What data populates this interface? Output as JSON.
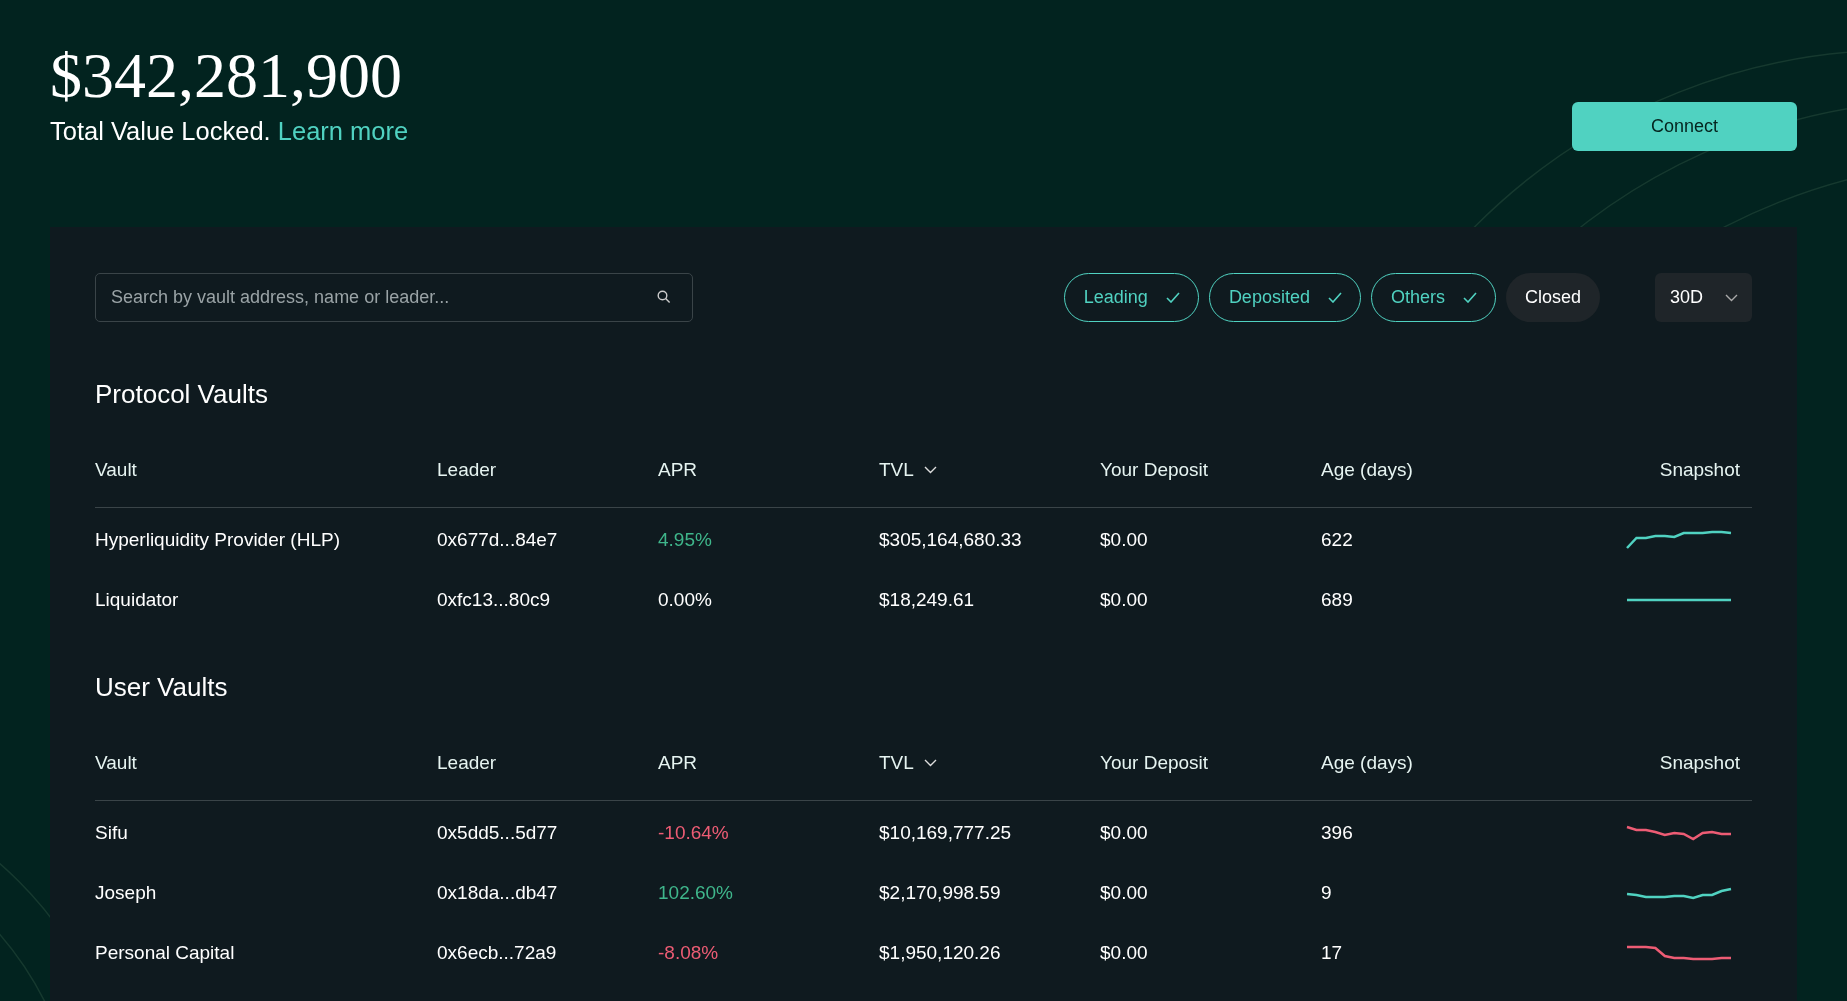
{
  "tvl": {
    "amount": "$342,281,900",
    "label": "Total Value Locked.",
    "link": "Learn more"
  },
  "connect_button": "Connect",
  "search": {
    "placeholder": "Search by vault address, name or leader..."
  },
  "filters": [
    {
      "label": "Leading",
      "selected": true
    },
    {
      "label": "Deposited",
      "selected": true
    },
    {
      "label": "Others",
      "selected": true
    },
    {
      "label": "Closed",
      "selected": false
    }
  ],
  "period_dropdown": "30D",
  "sections": [
    {
      "title": "Protocol Vaults",
      "columns": [
        "Vault",
        "Leader",
        "APR",
        "TVL",
        "Your Deposit",
        "Age (days)",
        "Snapshot"
      ],
      "rows": [
        {
          "vault": "Hyperliquidity Provider (HLP)",
          "leader": "0x677d...84e7",
          "apr": {
            "text": "4.95%",
            "color": "#3fb68b"
          },
          "tvl": "$305,164,680.33",
          "deposit": "$0.00",
          "age": "622",
          "snapshot": {
            "color": "#50d2c1"
          }
        },
        {
          "vault": "Liquidator",
          "leader": "0xfc13...80c9",
          "apr": {
            "text": "0.00%",
            "color": "#ffffff"
          },
          "tvl": "$18,249.61",
          "deposit": "$0.00",
          "age": "689",
          "snapshot": {
            "color": "#50d2c1"
          }
        }
      ]
    },
    {
      "title": "User Vaults",
      "columns": [
        "Vault",
        "Leader",
        "APR",
        "TVL",
        "Your Deposit",
        "Age (days)",
        "Snapshot"
      ],
      "rows": [
        {
          "vault": "Sifu",
          "leader": "0x5dd5...5d77",
          "apr": {
            "text": "-10.64%",
            "color": "#ed5c74"
          },
          "tvl": "$10,169,777.25",
          "deposit": "$0.00",
          "age": "396",
          "snapshot": {
            "color": "#ed5c74"
          }
        },
        {
          "vault": "Joseph",
          "leader": "0x18da...db47",
          "apr": {
            "text": "102.60%",
            "color": "#3fb68b"
          },
          "tvl": "$2,170,998.59",
          "deposit": "$0.00",
          "age": "9",
          "snapshot": {
            "color": "#50d2c1"
          }
        },
        {
          "vault": "Personal Capital",
          "leader": "0x6ecb...72a9",
          "apr": {
            "text": "-8.08%",
            "color": "#ed5c74"
          },
          "tvl": "$1,950,120.26",
          "deposit": "$0.00",
          "age": "17",
          "snapshot": {
            "color": "#ed5c74"
          }
        }
      ]
    }
  ]
}
